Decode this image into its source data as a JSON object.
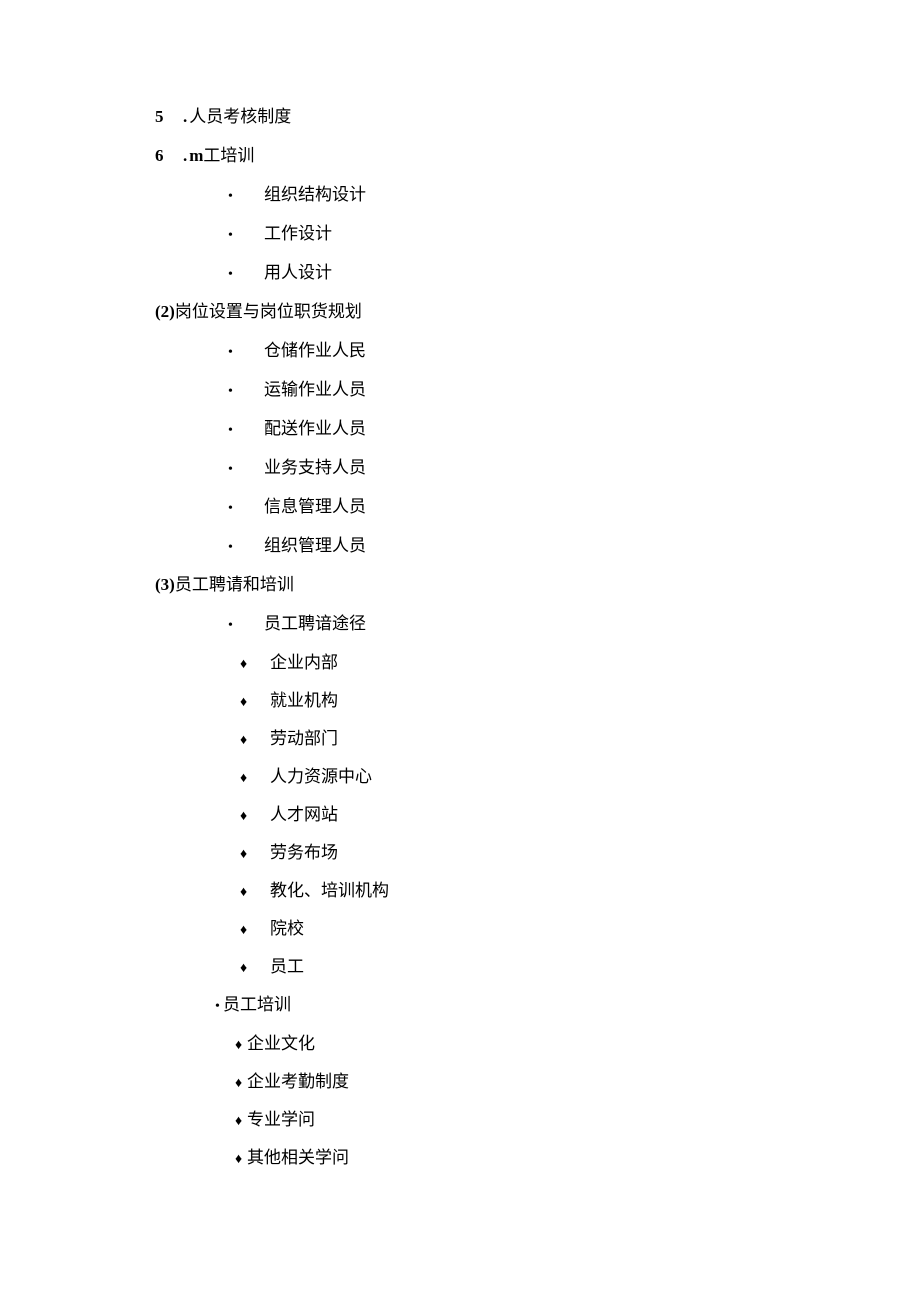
{
  "numbered": [
    {
      "num": "5",
      "text": ".人员考核制度"
    },
    {
      "num": "6",
      "text": ".m工培训"
    }
  ],
  "sub1": [
    "组织结构设计",
    "工作设计",
    "用人设计"
  ],
  "section2": {
    "paren": "(2)",
    "title": "岗位设置与岗位职货规划"
  },
  "sub2": [
    "仓储作业人民",
    "运输作业人员",
    "配送作业人员",
    "业务支持人员",
    "信息管理人员",
    "组织管理人员"
  ],
  "section3": {
    "paren": "(3)",
    "title": "员工聘请和培训"
  },
  "sub3_bullet": "员工聘谙途径",
  "sub3_diamonds": [
    "企业内部",
    "就业机构",
    "劳动部门",
    "人力资源中心",
    "人才网站",
    "劳务布场",
    "教化、培训机构",
    "院校",
    "员工"
  ],
  "sub4_bullet": "员工培训",
  "sub4_diamonds": [
    "企业文化",
    "企业考勤制度",
    "专业学问",
    "其他相关学问"
  ]
}
